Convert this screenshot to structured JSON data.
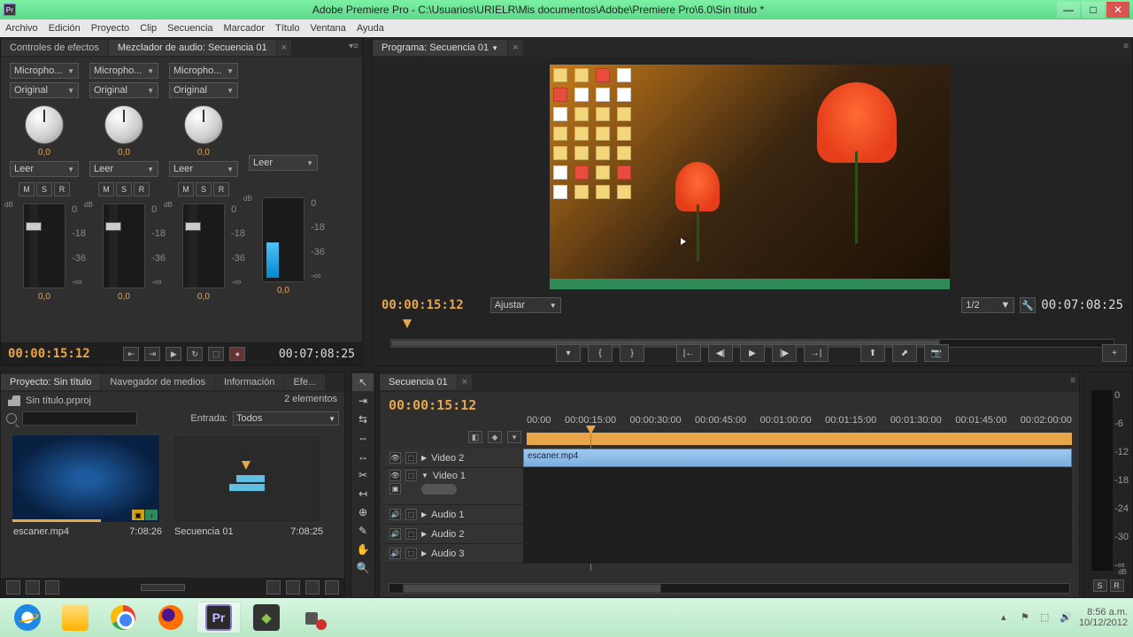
{
  "window": {
    "title": "Adobe Premiere Pro - C:\\Usuarios\\URIELR\\Mis documentos\\Adobe\\Premiere Pro\\6.0\\Sin título *"
  },
  "menu": [
    "Archivo",
    "Edición",
    "Proyecto",
    "Clip",
    "Secuencia",
    "Marcador",
    "Título",
    "Ventana",
    "Ayuda"
  ],
  "audioMixer": {
    "tabs": {
      "effects": "Controles de efectos",
      "mixer": "Mezclador de audio: Secuencia 01"
    },
    "micLabel": "Micropho...",
    "original": "Original",
    "knobVal": "0,0",
    "read": "Leer",
    "msr": {
      "m": "M",
      "s": "S",
      "r": "R"
    },
    "dbTop": "dB",
    "scale": [
      "0",
      "-18",
      "-36",
      "-∞"
    ],
    "bottomVal": "0,0",
    "footer": {
      "tc": "00:00:15:12",
      "dur": "00:07:08:25"
    }
  },
  "program": {
    "tab": "Programa: Secuencia 01",
    "tc": "00:00:15:12",
    "fit": "Ajustar",
    "zoom": "1/2",
    "dur": "00:07:08:25"
  },
  "project": {
    "tabs": {
      "project": "Proyecto: Sin título",
      "media": "Navegador de medios",
      "info": "Información",
      "efe": "Efe..."
    },
    "bin": "Sin título.prproj",
    "elements": "2 elementos",
    "entry": "Entrada:",
    "all": "Todos",
    "items": [
      {
        "name": "escaner.mp4",
        "dur": "7:08:26"
      },
      {
        "name": "Secuencia 01",
        "dur": "7:08:25"
      }
    ]
  },
  "timeline": {
    "tab": "Secuencia 01",
    "tc": "00:00:15:12",
    "ruler": [
      "00:00",
      "00:00:15:00",
      "00:00:30:00",
      "00:00:45:00",
      "00:01:00:00",
      "00:01:15:00",
      "00:01:30:00",
      "00:01:45:00",
      "00:02:00:00"
    ],
    "tracks": {
      "v2": "Video 2",
      "v1": "Video 1",
      "a1": "Audio 1",
      "a2": "Audio 2",
      "a3": "Audio 3"
    },
    "clip": "escaner.mp4"
  },
  "master": {
    "scale": [
      "0",
      "-6",
      "-12",
      "-18",
      "-24",
      "-30",
      "-∞"
    ],
    "s": "S",
    "r": "R",
    "db": "dB"
  },
  "systray": {
    "time": "8:56 a.m.",
    "date": "10/12/2012"
  }
}
